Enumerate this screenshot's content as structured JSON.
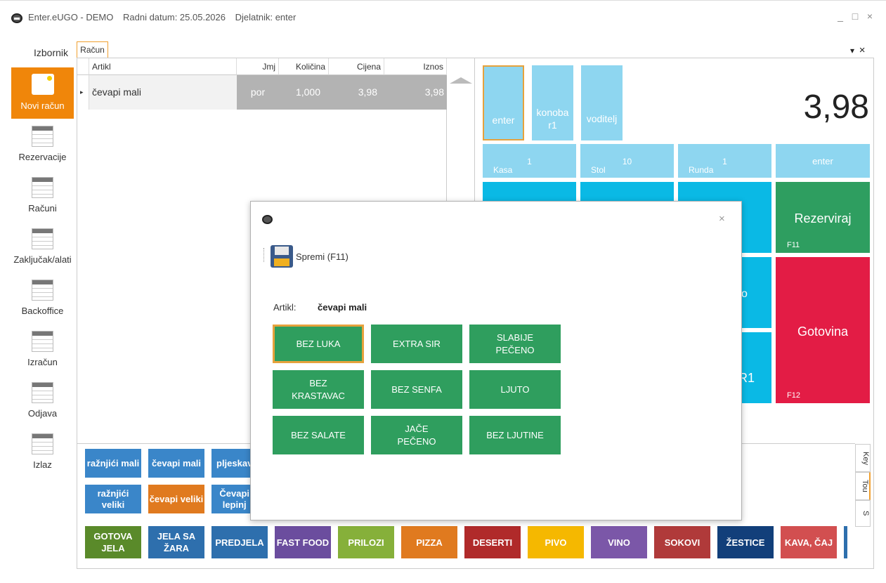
{
  "window": {
    "title": "Enter.eUGO - DEMO",
    "date": "Radni datum: 25.05.2026",
    "user": "Djelatnik: enter",
    "min": "_",
    "max": "□",
    "close": "×"
  },
  "sidebar": {
    "title": "Izbornik",
    "items": [
      "Novi račun",
      "Rezervacije",
      "Računi",
      "Zaključak/alati",
      "Backoffice",
      "Izračun",
      "Odjava",
      "Izlaz"
    ]
  },
  "tab": {
    "label": "Račun",
    "pin": "▾",
    "close": "×"
  },
  "grid": {
    "headers": [
      "Artikl",
      "Jmj",
      "Količina",
      "Cijena",
      "Iznos"
    ],
    "rows": [
      {
        "marker": "▸",
        "artikl": "čevapi mali",
        "jmj": "por",
        "kolicina": "1,000",
        "cijena": "3,98",
        "iznos": "3,98"
      }
    ]
  },
  "users": [
    "enter",
    "konoba\nr1",
    "voditelj"
  ],
  "total": "3,98",
  "info": [
    {
      "key": "Kasa",
      "value": "1"
    },
    {
      "key": "Stol",
      "value": "10"
    },
    {
      "key": "Runda",
      "value": "1"
    },
    {
      "key": "",
      "value": "enter"
    }
  ],
  "actions": {
    "rezerviraj": "Rezerviraj",
    "rezerviraj_key": "F11",
    "gotovina": "Gotovina",
    "gotovina_key": "F12",
    "partial1": "o",
    "partial2": "R1"
  },
  "products": [
    "ražnjići mali",
    "čevapi mali",
    "pljeskav",
    "ražnjići veliki",
    "čevapi veliki",
    "Čevapi\nlepinj"
  ],
  "categories": [
    {
      "label": "GOTOVA\nJELA",
      "color": "#5a8a2a"
    },
    {
      "label": "JELA SA\nŽARA",
      "color": "#2e6fad"
    },
    {
      "label": "PREDJELA",
      "color": "#2e6fad"
    },
    {
      "label": "FAST FOOD",
      "color": "#6b4d9e"
    },
    {
      "label": "PRILOZI",
      "color": "#86b03a"
    },
    {
      "label": "PIZZA",
      "color": "#e07a1f"
    },
    {
      "label": "DESERTI",
      "color": "#b02a2a"
    },
    {
      "label": "PIVO",
      "color": "#f5b800"
    },
    {
      "label": "VINO",
      "color": "#7b57a8"
    },
    {
      "label": "SOKOVI",
      "color": "#b03a3a"
    },
    {
      "label": "ŽESTICE",
      "color": "#123f7a"
    },
    {
      "label": "KAVA, ČAJ",
      "color": "#d24f50"
    }
  ],
  "vtabs": [
    "Key",
    "Tou",
    "S"
  ],
  "dialog": {
    "close": "×",
    "save": "Spremi (F11)",
    "artikl_label": "Artikl:",
    "artikl_value": "čevapi mali",
    "modifiers": [
      "BEZ LUKA",
      "EXTRA SIR",
      "SLABIJE\nPEČENO",
      "BEZ\nKRASTAVAC",
      "BEZ SENFA",
      "LJUTO",
      "BEZ SALATE",
      "JAČE\nPEČENO",
      "BEZ LJUTINE"
    ]
  },
  "colors": {
    "accent": "#f0860a",
    "tile_light": "#8ed6f0",
    "tile_cyan": "#0ab9e5",
    "green": "#2e9e60",
    "red": "#e31c45"
  }
}
